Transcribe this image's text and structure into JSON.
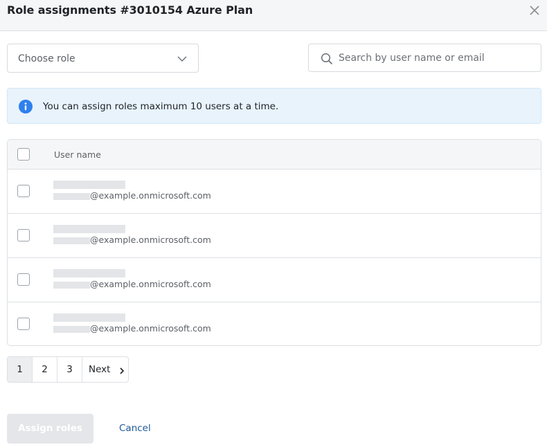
{
  "dialog": {
    "title": "Role assignments #3010154 Azure Plan",
    "close_icon": "close-icon"
  },
  "filters": {
    "role_select": {
      "selected": "Choose role",
      "icon": "chevron-down-icon"
    },
    "search": {
      "placeholder": "Search by user name or email",
      "value": "",
      "icon": "search-icon"
    }
  },
  "info_banner": {
    "icon": "info-icon",
    "text": "You can assign roles maximum 10 users at a time.",
    "color": "#2f80ed"
  },
  "table": {
    "columns": [
      "User name"
    ],
    "rows": [
      {
        "email_domain": "@example.onmicrosoft.com",
        "checked": false
      },
      {
        "email_domain": "@example.onmicrosoft.com",
        "checked": false
      },
      {
        "email_domain": "@example.onmicrosoft.com",
        "checked": false
      },
      {
        "email_domain": "@example.onmicrosoft.com",
        "checked": false
      }
    ]
  },
  "pagination": {
    "pages": [
      "1",
      "2",
      "3"
    ],
    "current": "1",
    "next_label": "Next"
  },
  "footer": {
    "assign_label": "Assign roles",
    "cancel_label": "Cancel"
  }
}
